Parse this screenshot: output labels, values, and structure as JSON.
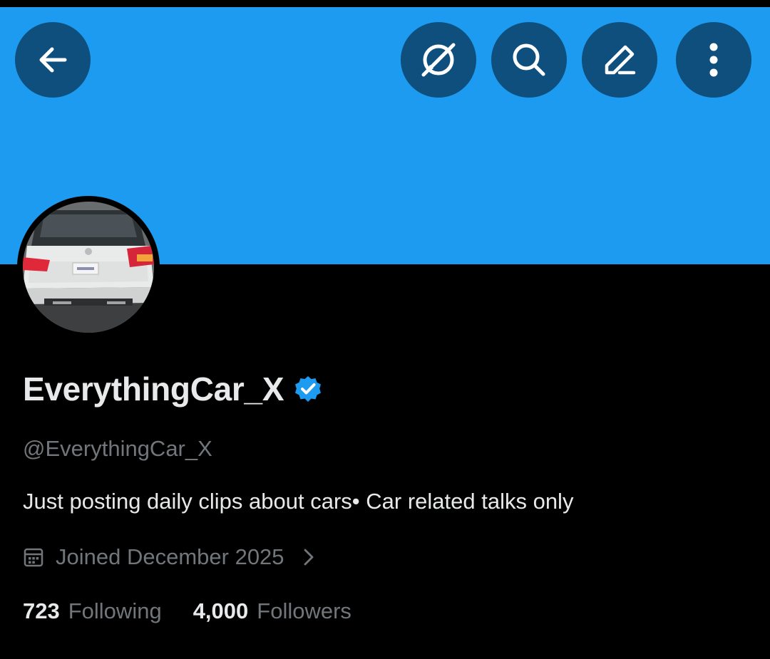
{
  "header": {
    "banner_color": "#1d9bf0",
    "button_color": "#0e4f7d",
    "buttons": [
      {
        "icon": "back-arrow-icon"
      },
      {
        "icon": "grok-icon"
      },
      {
        "icon": "search-icon"
      },
      {
        "icon": "edit-icon"
      },
      {
        "icon": "more-vertical-icon"
      }
    ]
  },
  "profile": {
    "avatar": "white-suv-rear-photo",
    "display_name": "EverythingCar_X",
    "verified": true,
    "verified_color": "#1d9bf0",
    "handle": "@EverythingCar_X",
    "bio": "Just posting daily clips about cars• Car related talks only",
    "joined": "Joined December 2025"
  },
  "stats": {
    "following_count": "723",
    "following_label": "Following",
    "followers_count": "4,000",
    "followers_label": "Followers"
  }
}
